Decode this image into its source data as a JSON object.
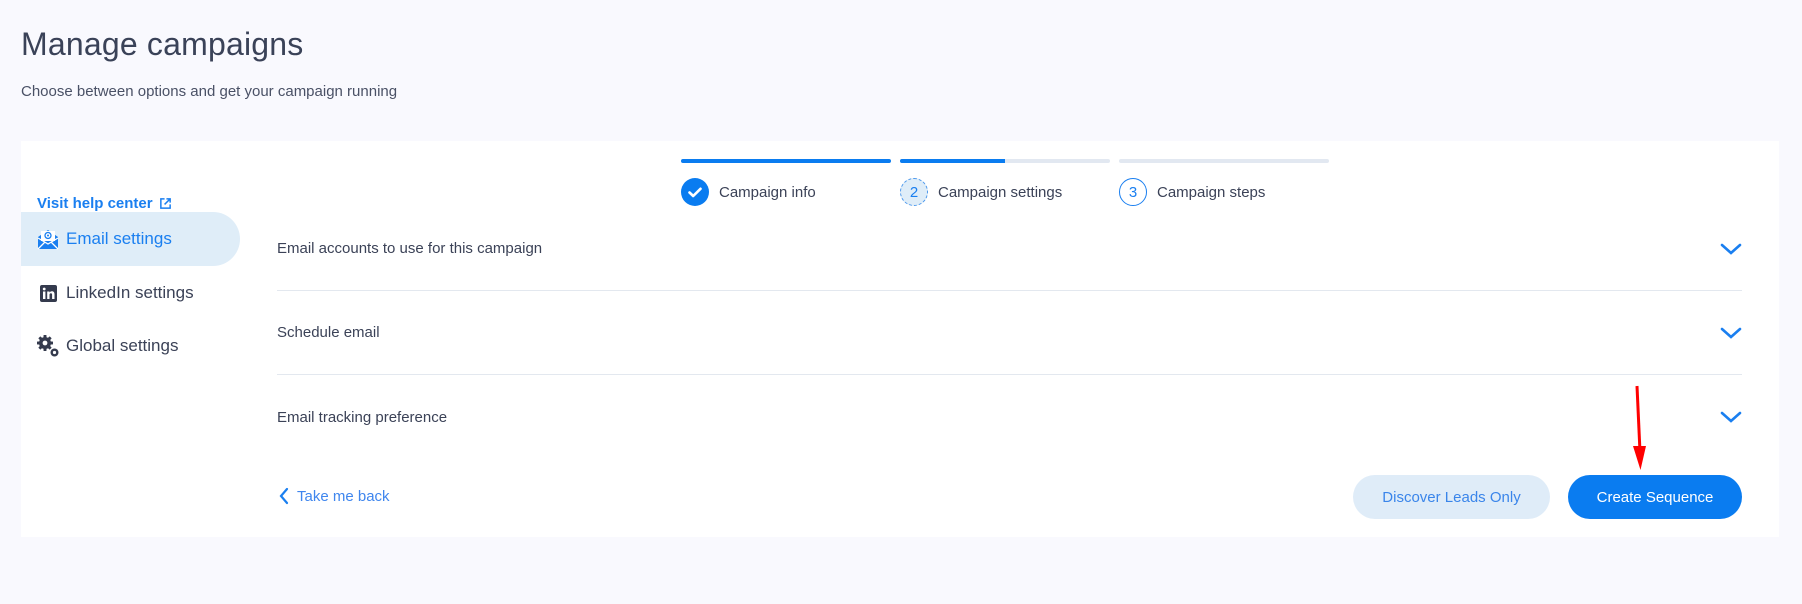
{
  "header": {
    "title": "Manage campaigns",
    "subtitle": "Choose between options and get your campaign running"
  },
  "sidebar": {
    "help_link": "Visit help center",
    "items": [
      {
        "label": "Email settings",
        "icon": "email-envelope-icon",
        "active": true
      },
      {
        "label": "LinkedIn settings",
        "icon": "linkedin-icon",
        "active": false
      },
      {
        "label": "Global settings",
        "icon": "gears-icon",
        "active": false
      }
    ]
  },
  "stepper": {
    "steps": [
      {
        "number": "1",
        "label": "Campaign info",
        "state": "done",
        "progress": 1.0
      },
      {
        "number": "2",
        "label": "Campaign settings",
        "state": "current",
        "progress": 0.5
      },
      {
        "number": "3",
        "label": "Campaign steps",
        "state": "pending",
        "progress": 0.0
      }
    ]
  },
  "sections": [
    {
      "label": "Email accounts to use for this campaign",
      "expanded": false
    },
    {
      "label": "Schedule email",
      "expanded": false
    },
    {
      "label": "Email tracking preference",
      "expanded": false
    }
  ],
  "footer": {
    "back_label": "Take me back",
    "secondary_button": "Discover Leads Only",
    "primary_button": "Create Sequence"
  },
  "colors": {
    "accent": "#0a7cf0",
    "accent_light": "#dfedf8",
    "text": "#3b4257",
    "annotation": "#ff0000"
  }
}
